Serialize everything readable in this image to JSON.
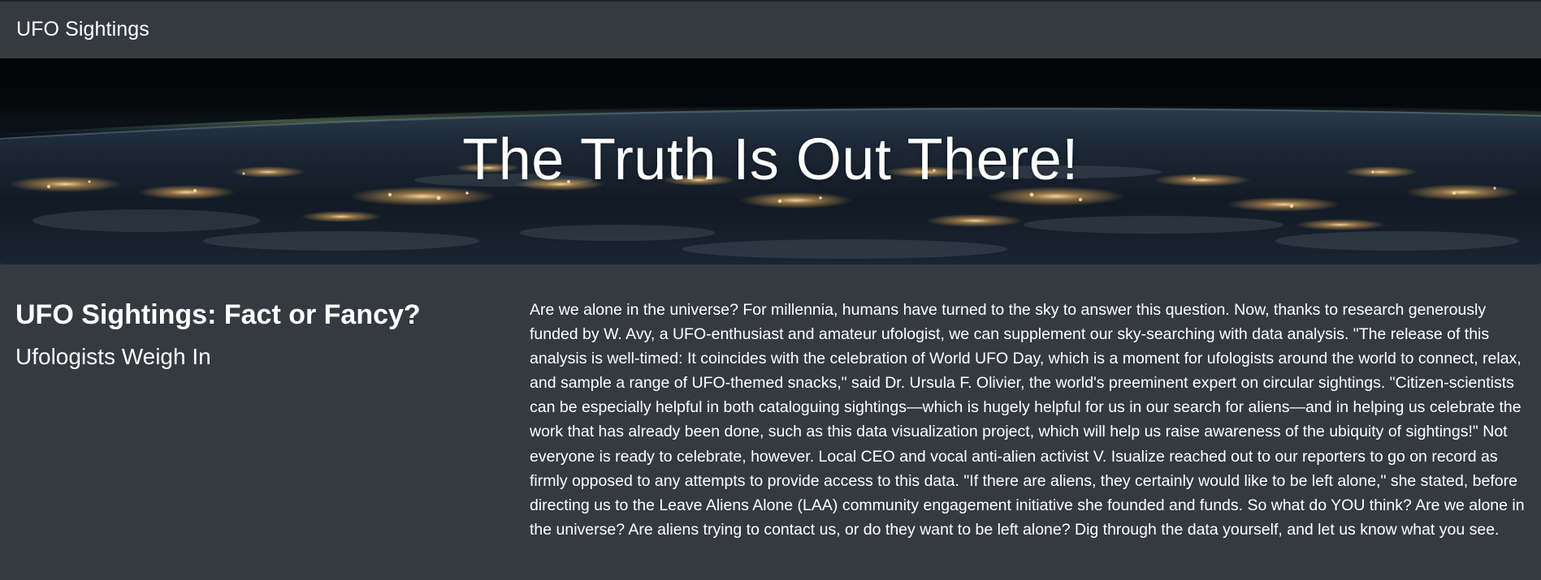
{
  "navbar": {
    "brand": "UFO Sightings"
  },
  "hero": {
    "title": "The Truth Is Out There!"
  },
  "article": {
    "title": "UFO Sightings: Fact or Fancy?",
    "subtitle": "Ufologists Weigh In",
    "body": "Are we alone in the universe? For millennia, humans have turned to the sky to answer this question. Now, thanks to research generously funded by W. Avy, a UFO-enthusiast and amateur ufologist, we can supplement our sky-searching with data analysis. \"The release of this analysis is well-timed: It coincides with the celebration of World UFO Day, which is a moment for ufologists around the world to connect, relax, and sample a range of UFO-themed snacks,\" said Dr. Ursula F. Olivier, the world's preeminent expert on circular sightings. \"Citizen-scientists can be especially helpful in both cataloguing sightings—which is hugely helpful for us in our search for aliens—and in helping us celebrate the work that has already been done, such as this data visualization project, which will help us raise awareness of the ubiquity of sightings!\" Not everyone is ready to celebrate, however. Local CEO and vocal anti-alien activist V. Isualize reached out to our reporters to go on record as firmly opposed to any attempts to provide access to this data. \"If there are aliens, they certainly would like to be left alone,\" she stated, before directing us to the Leave Aliens Alone (LAA) community engagement initiative she founded and funds. So what do YOU think? Are we alone in the universe? Are aliens trying to contact us, or do they want to be left alone? Dig through the data yourself, and let us know what you see."
  },
  "colors": {
    "background": "#343a40",
    "text": "#ffffff",
    "hero_space": "#020304",
    "city_lights": "#ffd38a"
  }
}
